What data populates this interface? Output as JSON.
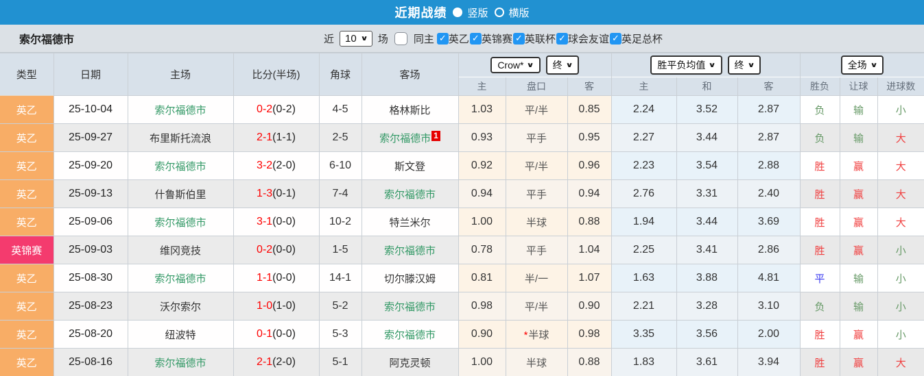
{
  "topbar": {
    "title": "近期战绩",
    "radio_vertical": "竖版",
    "radio_horizontal": "横版",
    "selected": "竖版"
  },
  "filterbar": {
    "team": "索尔福德市",
    "recent_label": "近",
    "recent_count": "10",
    "unit_label": "场",
    "same_home": {
      "label": "同主",
      "checked": false
    },
    "leagues": [
      {
        "label": "英乙",
        "checked": true
      },
      {
        "label": "英锦赛",
        "checked": true
      },
      {
        "label": "英联杯",
        "checked": true
      },
      {
        "label": "球会友谊",
        "checked": true
      },
      {
        "label": "英足总杯",
        "checked": true
      }
    ]
  },
  "table": {
    "columns_left": [
      "类型",
      "日期",
      "主场",
      "比分(半场)",
      "角球",
      "客场"
    ],
    "dropdowns": {
      "odds_company": "Crow*",
      "odds_final": "终",
      "avg": "胜平负均值",
      "avg_final": "终",
      "period": "全场"
    },
    "sub_headers": [
      "主",
      "盘口",
      "客",
      "主",
      "和",
      "客",
      "胜负",
      "让球",
      "进球数"
    ],
    "rows": [
      {
        "league": "英乙",
        "league_type": "l2",
        "date": "25-10-04",
        "home": "索尔福德市",
        "home_highlight": true,
        "score": "0-2",
        "half": "(0-2)",
        "corners": "4-5",
        "away": "格林斯比",
        "away_highlight": false,
        "away_sup": "",
        "odds": [
          "1.03",
          "平/半",
          "0.85"
        ],
        "odds_star": false,
        "avg": [
          "2.24",
          "3.52",
          "2.87"
        ],
        "result": [
          "负",
          "softgreen"
        ],
        "handicap": [
          "输",
          "softgreen"
        ],
        "goals": [
          "小",
          "softgreen"
        ]
      },
      {
        "league": "英乙",
        "league_type": "l2",
        "date": "25-09-27",
        "home": "布里斯托流浪",
        "home_highlight": false,
        "score": "2-1",
        "half": "(1-1)",
        "corners": "2-5",
        "away": "索尔福德市",
        "away_highlight": true,
        "away_sup": "1",
        "odds": [
          "0.93",
          "平手",
          "0.95"
        ],
        "odds_star": false,
        "avg": [
          "2.27",
          "3.44",
          "2.87"
        ],
        "result": [
          "负",
          "softgreen"
        ],
        "handicap": [
          "输",
          "softgreen"
        ],
        "goals": [
          "大",
          "red"
        ]
      },
      {
        "league": "英乙",
        "league_type": "l2",
        "date": "25-09-20",
        "home": "索尔福德市",
        "home_highlight": true,
        "score": "3-2",
        "half": "(2-0)",
        "corners": "6-10",
        "away": "斯文登",
        "away_highlight": false,
        "away_sup": "",
        "odds": [
          "0.92",
          "平/半",
          "0.96"
        ],
        "odds_star": false,
        "avg": [
          "2.23",
          "3.54",
          "2.88"
        ],
        "result": [
          "胜",
          "red"
        ],
        "handicap": [
          "赢",
          "red"
        ],
        "goals": [
          "大",
          "red"
        ]
      },
      {
        "league": "英乙",
        "league_type": "l2",
        "date": "25-09-13",
        "home": "什鲁斯伯里",
        "home_highlight": false,
        "score": "1-3",
        "half": "(0-1)",
        "corners": "7-4",
        "away": "索尔福德市",
        "away_highlight": true,
        "away_sup": "",
        "odds": [
          "0.94",
          "平手",
          "0.94"
        ],
        "odds_star": false,
        "avg": [
          "2.76",
          "3.31",
          "2.40"
        ],
        "result": [
          "胜",
          "red"
        ],
        "handicap": [
          "赢",
          "red"
        ],
        "goals": [
          "大",
          "red"
        ]
      },
      {
        "league": "英乙",
        "league_type": "l2",
        "date": "25-09-06",
        "home": "索尔福德市",
        "home_highlight": true,
        "score": "3-1",
        "half": "(0-0)",
        "corners": "10-2",
        "away": "特兰米尔",
        "away_highlight": false,
        "away_sup": "",
        "odds": [
          "1.00",
          "半球",
          "0.88"
        ],
        "odds_star": false,
        "avg": [
          "1.94",
          "3.44",
          "3.69"
        ],
        "result": [
          "胜",
          "red"
        ],
        "handicap": [
          "赢",
          "red"
        ],
        "goals": [
          "大",
          "red"
        ]
      },
      {
        "league": "英锦赛",
        "league_type": "cup",
        "date": "25-09-03",
        "home": "维冈竞技",
        "home_highlight": false,
        "score": "0-2",
        "half": "(0-0)",
        "corners": "1-5",
        "away": "索尔福德市",
        "away_highlight": true,
        "away_sup": "",
        "odds": [
          "0.78",
          "平手",
          "1.04"
        ],
        "odds_star": false,
        "avg": [
          "2.25",
          "3.41",
          "2.86"
        ],
        "result": [
          "胜",
          "red"
        ],
        "handicap": [
          "赢",
          "red"
        ],
        "goals": [
          "小",
          "softgreen"
        ]
      },
      {
        "league": "英乙",
        "league_type": "l2",
        "date": "25-08-30",
        "home": "索尔福德市",
        "home_highlight": true,
        "score": "1-1",
        "half": "(0-0)",
        "corners": "14-1",
        "away": "切尔滕汉姆",
        "away_highlight": false,
        "away_sup": "",
        "odds": [
          "0.81",
          "半/一",
          "1.07"
        ],
        "odds_star": false,
        "avg": [
          "1.63",
          "3.88",
          "4.81"
        ],
        "result": [
          "平",
          "blue"
        ],
        "handicap": [
          "输",
          "softgreen"
        ],
        "goals": [
          "小",
          "softgreen"
        ]
      },
      {
        "league": "英乙",
        "league_type": "l2",
        "date": "25-08-23",
        "home": "沃尔索尔",
        "home_highlight": false,
        "score": "1-0",
        "half": "(1-0)",
        "corners": "5-2",
        "away": "索尔福德市",
        "away_highlight": true,
        "away_sup": "",
        "odds": [
          "0.98",
          "平/半",
          "0.90"
        ],
        "odds_star": false,
        "avg": [
          "2.21",
          "3.28",
          "3.10"
        ],
        "result": [
          "负",
          "softgreen"
        ],
        "handicap": [
          "输",
          "softgreen"
        ],
        "goals": [
          "小",
          "softgreen"
        ]
      },
      {
        "league": "英乙",
        "league_type": "l2",
        "date": "25-08-20",
        "home": "纽波特",
        "home_highlight": false,
        "score": "0-1",
        "half": "(0-0)",
        "corners": "5-3",
        "away": "索尔福德市",
        "away_highlight": true,
        "away_sup": "",
        "odds": [
          "0.90",
          "半球",
          "0.98"
        ],
        "odds_star": true,
        "avg": [
          "3.35",
          "3.56",
          "2.00"
        ],
        "result": [
          "胜",
          "red"
        ],
        "handicap": [
          "赢",
          "red"
        ],
        "goals": [
          "小",
          "softgreen"
        ]
      },
      {
        "league": "英乙",
        "league_type": "l2",
        "date": "25-08-16",
        "home": "索尔福德市",
        "home_highlight": true,
        "score": "2-1",
        "half": "(2-0)",
        "corners": "5-1",
        "away": "阿克灵顿",
        "away_highlight": false,
        "away_sup": "",
        "odds": [
          "1.00",
          "半球",
          "0.88"
        ],
        "odds_star": false,
        "avg": [
          "1.83",
          "3.61",
          "3.94"
        ],
        "result": [
          "胜",
          "red"
        ],
        "handicap": [
          "赢",
          "red"
        ],
        "goals": [
          "大",
          "red"
        ]
      }
    ]
  },
  "colors": {
    "topbar_bg": "#2191d1",
    "filterbar_bg": "#dce1e6",
    "header_bg": "#d8e1ea",
    "checkbox_blue": "#2196f3",
    "league_l2_bg": "#f8ad66",
    "league_cup_bg": "#f43b6e",
    "team_highlight_green": "#339966",
    "score_red": "#fd0000",
    "win_red": "#f03e3e",
    "lose_green": "#669966",
    "draw_blue": "#3b3bf0"
  }
}
